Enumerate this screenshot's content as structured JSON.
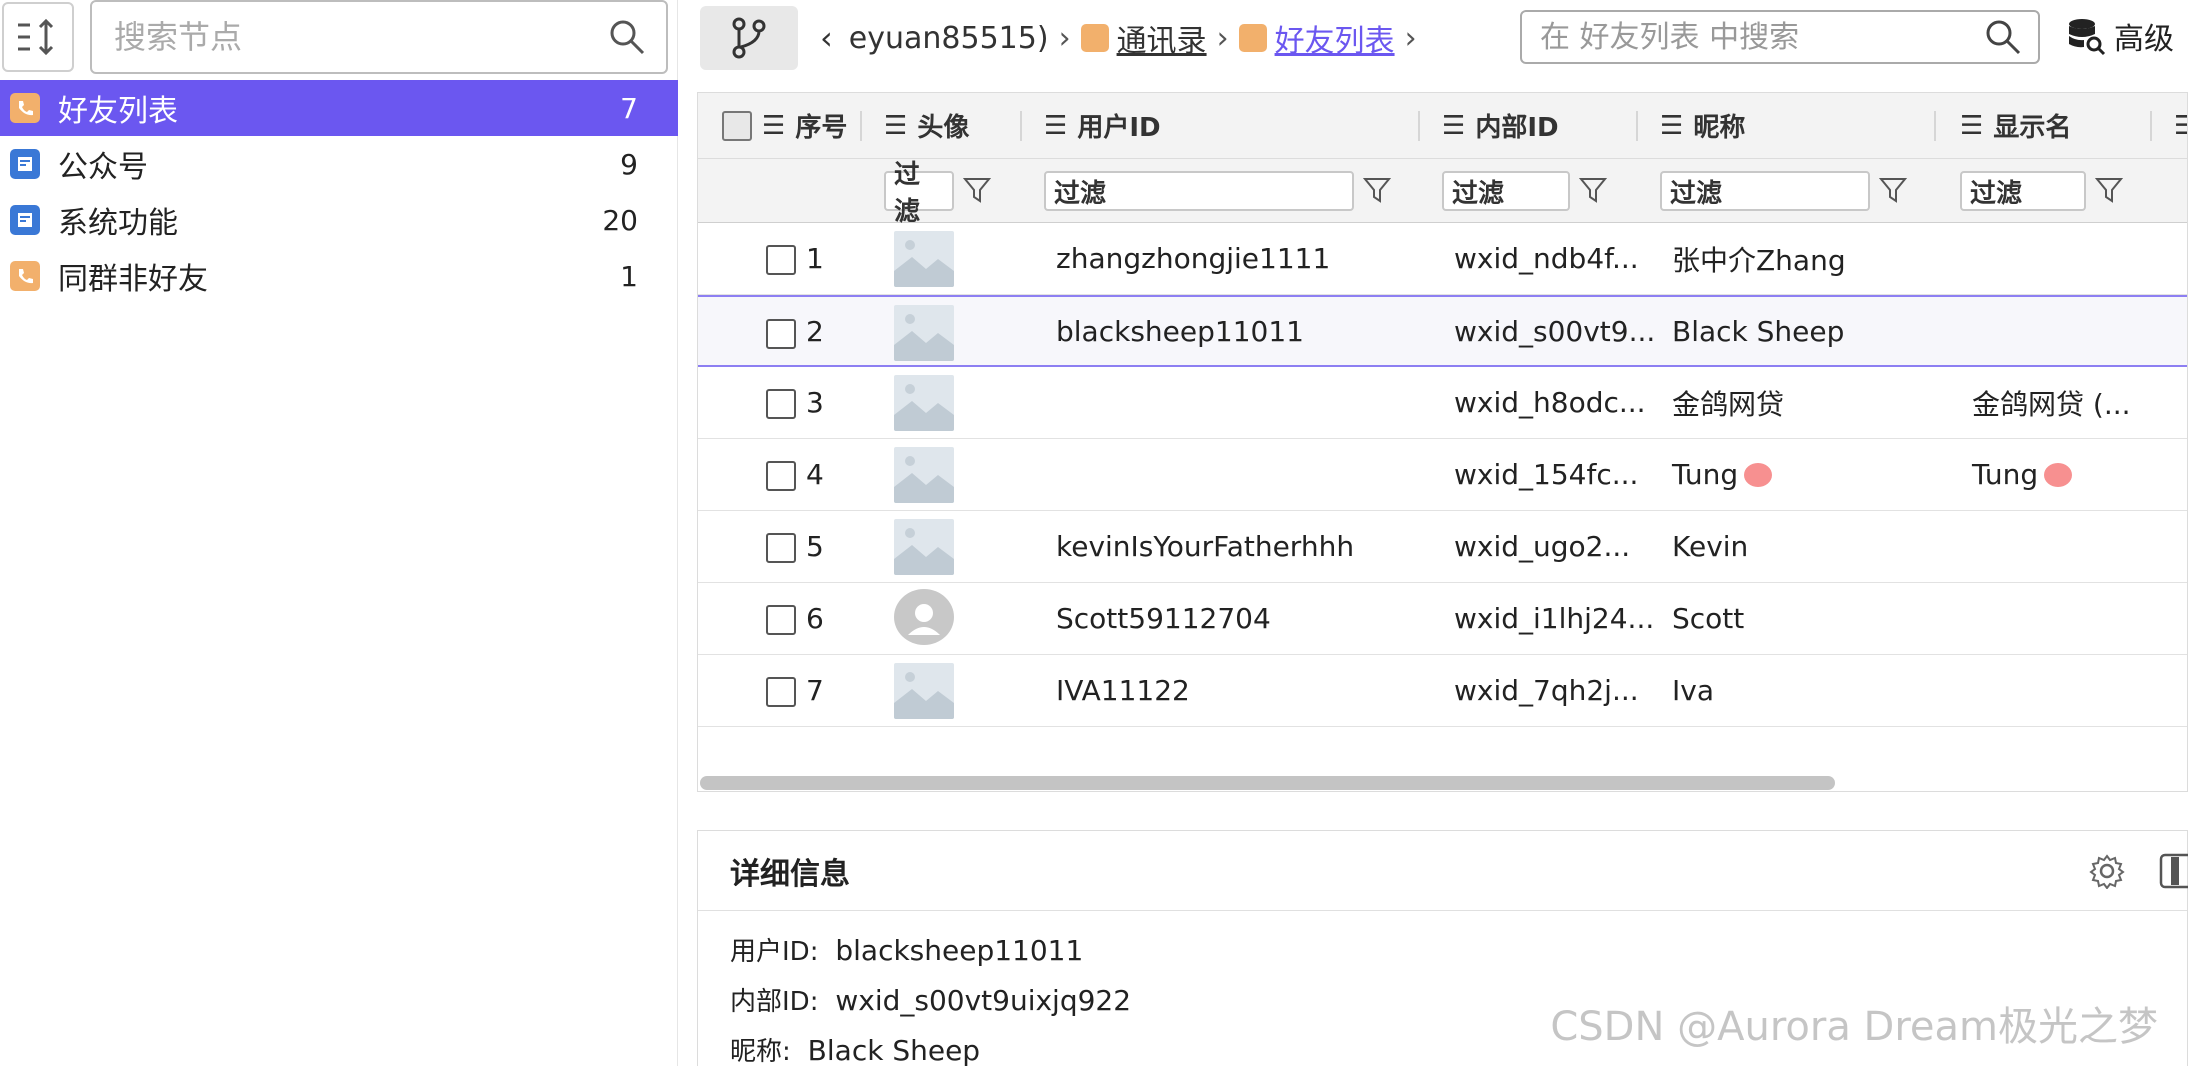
{
  "sidebar": {
    "search_placeholder": "搜索节点",
    "items": [
      {
        "label": "好友列表",
        "count": "7"
      },
      {
        "label": "公众号",
        "count": "9"
      },
      {
        "label": "系统功能",
        "count": "20"
      },
      {
        "label": "同群非好友",
        "count": "1"
      }
    ]
  },
  "topbar": {
    "crumbs": [
      "eyuan85515)",
      "通讯录",
      "好友列表"
    ],
    "search_placeholder": "在 好友列表 中搜索",
    "advanced": "高级"
  },
  "grid": {
    "headers": [
      "序号",
      "头像",
      "用户ID",
      "内部ID",
      "昵称",
      "显示名"
    ],
    "filter_label": "过滤",
    "rows": [
      {
        "num": "1",
        "user_id": "zhangzhongjie1111",
        "inner_id": "wxid_ndb4f...",
        "nick": "张中介Zhang",
        "display": ""
      },
      {
        "num": "2",
        "user_id": "blacksheep11011",
        "inner_id": "wxid_s00vt9...",
        "nick": "Black Sheep",
        "display": ""
      },
      {
        "num": "3",
        "user_id": "",
        "inner_id": "wxid_h8odc...",
        "nick": "金鸽网贷",
        "display": "金鸽网贷 (..."
      },
      {
        "num": "4",
        "user_id": "",
        "inner_id": "wxid_154fc...",
        "nick": "Tung",
        "display": "Tung"
      },
      {
        "num": "5",
        "user_id": "kevinIsYourFatherhhh",
        "inner_id": "wxid_ugo2...",
        "nick": "Kevin",
        "display": ""
      },
      {
        "num": "6",
        "user_id": "Scott59112704",
        "inner_id": "wxid_i1lhj24...",
        "nick": "Scott",
        "display": ""
      },
      {
        "num": "7",
        "user_id": "IVA11122",
        "inner_id": "wxid_7qh2j...",
        "nick": "Iva",
        "display": ""
      }
    ]
  },
  "details": {
    "title": "详细信息",
    "fields": [
      {
        "key": "用户ID:",
        "value": "blacksheep11011"
      },
      {
        "key": "内部ID:",
        "value": "wxid_s00vt9uixjq922"
      },
      {
        "key": "昵称:",
        "value": "Black Sheep"
      }
    ]
  },
  "watermark": "CSDN @Aurora Dream极光之梦",
  "colors": {
    "accent": "#6b57f0",
    "contact_icon": "#f2b06c",
    "app_icon": "#3a78d6"
  }
}
